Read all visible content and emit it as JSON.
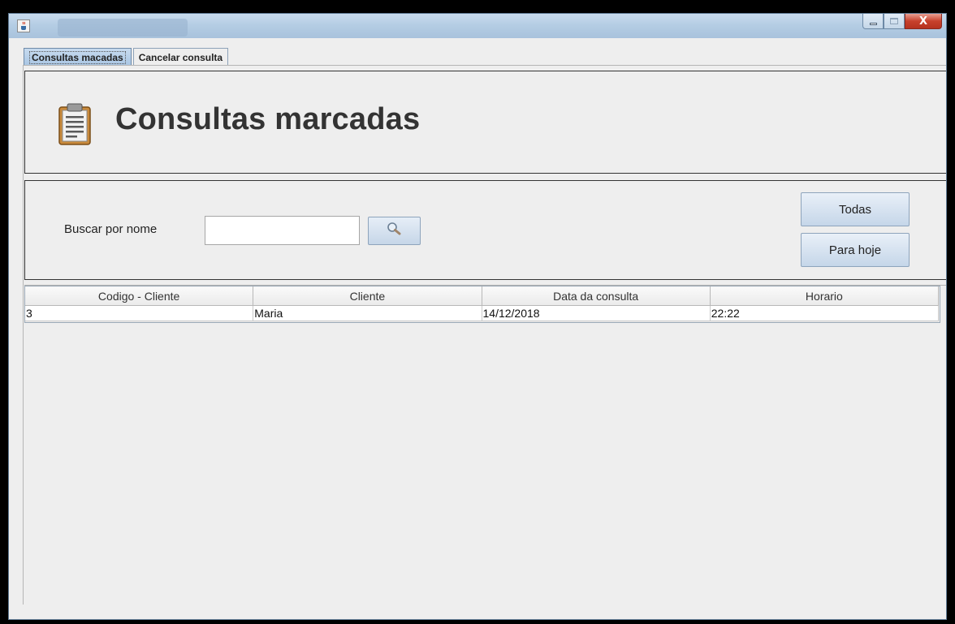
{
  "window": {
    "app_icon": "java-coffee-icon",
    "controls": {
      "minimize": "minimize-icon",
      "maximize": "maximize-icon",
      "close_glyph": "X"
    }
  },
  "tabs": [
    {
      "label": "Consultas macadas",
      "active": true
    },
    {
      "label": "Cancelar consulta",
      "active": false
    }
  ],
  "header": {
    "icon": "clipboard-icon",
    "title": "Consultas marcadas"
  },
  "search": {
    "label": "Buscar por nome",
    "value": "",
    "button_icon": "magnifier-icon"
  },
  "buttons": {
    "todas": "Todas",
    "para_hoje": "Para hoje"
  },
  "table": {
    "columns": [
      "Codigo - Cliente",
      "Cliente",
      "Data da consulta",
      "Horario"
    ],
    "rows": [
      [
        "3",
        "Maria",
        "14/12/2018",
        "22:22"
      ]
    ]
  },
  "colors": {
    "background": "#eeeeee",
    "titlebar": "#b5cde4",
    "close_button": "#c7412c",
    "title_text": "#333333"
  }
}
